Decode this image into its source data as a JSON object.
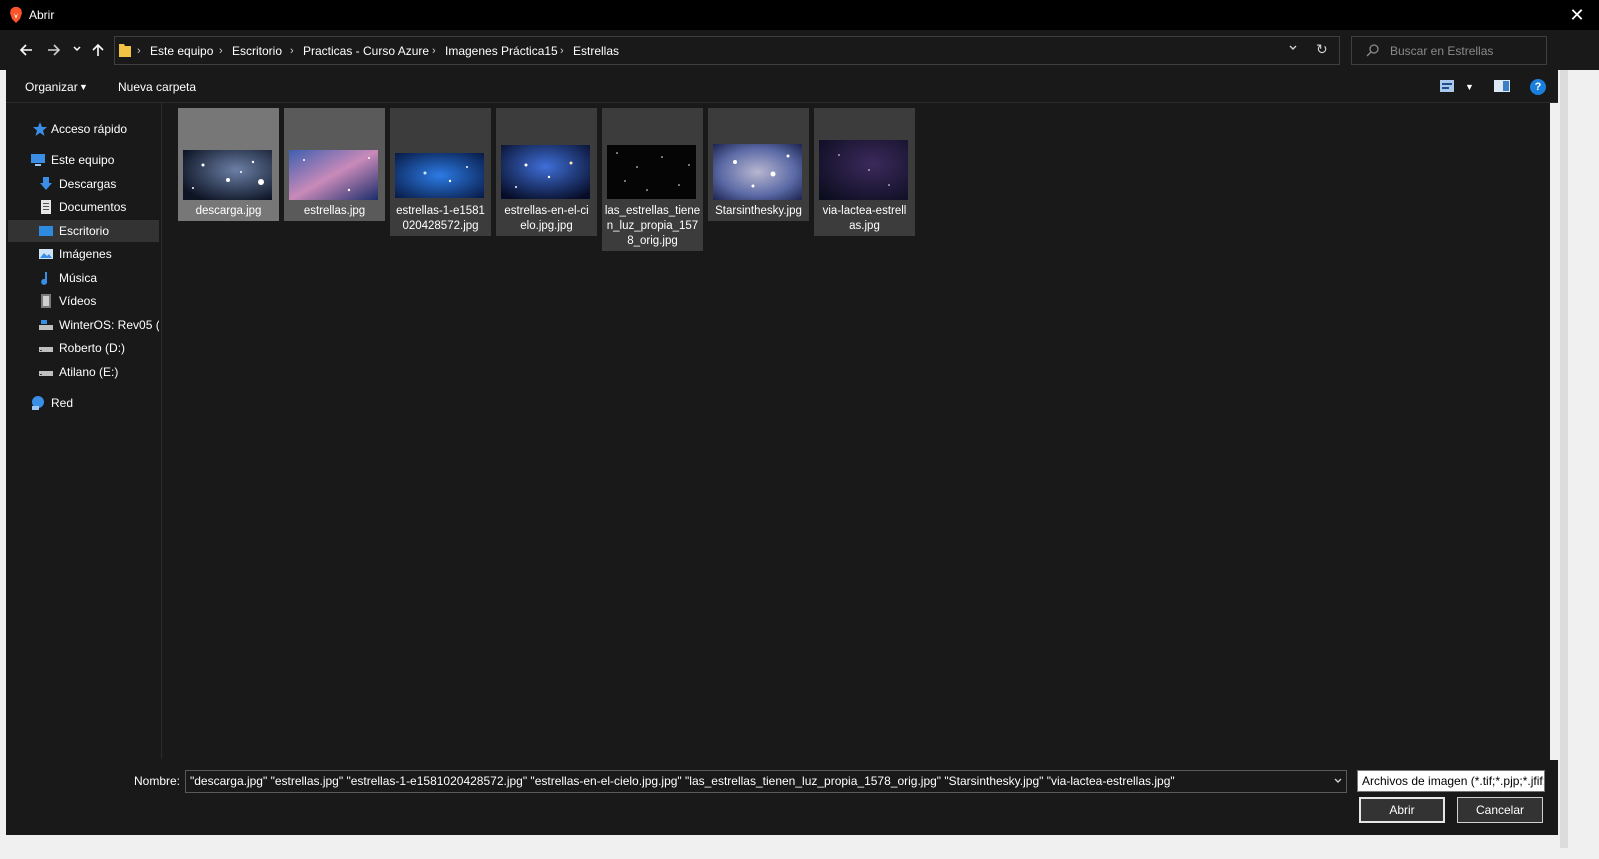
{
  "window": {
    "title": "Abrir",
    "app_icon": "brave-lion-icon"
  },
  "nav": {
    "back_icon": "arrow-left-icon",
    "forward_icon": "arrow-right-icon",
    "recent_icon": "chevron-down-icon",
    "up_icon": "arrow-up-icon"
  },
  "breadcrumb": [
    "Este equipo",
    "Escritorio",
    "Practicas - Curso Azure",
    "Imagenes Práctica15",
    "Estrellas"
  ],
  "search": {
    "placeholder": "Buscar en Estrellas"
  },
  "toolbar": {
    "organize": "Organizar",
    "new_folder": "Nueva carpeta",
    "help": "?"
  },
  "sidebar": {
    "items": [
      {
        "label": "Acceso rápido",
        "icon": "star-icon"
      },
      {
        "label": "Este equipo",
        "icon": "computer-icon"
      },
      {
        "label": "Descargas",
        "icon": "download-arrow-icon"
      },
      {
        "label": "Documentos",
        "icon": "document-icon"
      },
      {
        "label": "Escritorio",
        "icon": "desktop-icon",
        "selected": true
      },
      {
        "label": "Imágenes",
        "icon": "pictures-icon"
      },
      {
        "label": "Música",
        "icon": "music-note-icon"
      },
      {
        "label": "Vídeos",
        "icon": "video-icon"
      },
      {
        "label": "WinterOS: Rev05  (C",
        "icon": "system-drive-icon"
      },
      {
        "label": "Roberto (D:)",
        "icon": "drive-icon"
      },
      {
        "label": "Atilano (E:)",
        "icon": "drive-icon"
      },
      {
        "label": "Red",
        "icon": "network-icon"
      }
    ]
  },
  "files": [
    {
      "name": "descarga.jpg",
      "selected": true
    },
    {
      "name": "estrellas.jpg",
      "selected": true
    },
    {
      "name": "estrellas-1-e1581020428572.jpg",
      "display": "estrellas-1-e1581\n020428572.jpg",
      "selected": true
    },
    {
      "name": "estrellas-en-el-cielo.jpg.jpg",
      "display": "estrellas-en-el-ci\nelo.jpg.jpg",
      "selected": true
    },
    {
      "name": "las_estrellas_tienen_luz_propia_1578_orig.jpg",
      "display": "las_estrellas_tiene\nn_luz_propia_157\n8_orig.jpg",
      "selected": true
    },
    {
      "name": "Starsinthesky.jpg",
      "selected": true
    },
    {
      "name": "via-lactea-estrellas.jpg",
      "display": "via-lactea-estrell\nas.jpg",
      "selected": true
    }
  ],
  "footer": {
    "name_label": "Nombre:",
    "name_value": "\"descarga.jpg\" \"estrellas.jpg\" \"estrellas-1-e1581020428572.jpg\" \"estrellas-en-el-cielo.jpg.jpg\" \"las_estrellas_tienen_luz_propia_1578_orig.jpg\" \"Starsinthesky.jpg\" \"via-lactea-estrellas.jpg\"",
    "file_type": "Archivos de imagen (*.tif;*.pjp;*.jfif;*.ico",
    "open_button": "Abrir",
    "cancel_button": "Cancelar"
  },
  "colors": {
    "accent": "#1a7fdc",
    "background": "#191919",
    "tile": "#3c3c3c",
    "selection": "#333333"
  }
}
